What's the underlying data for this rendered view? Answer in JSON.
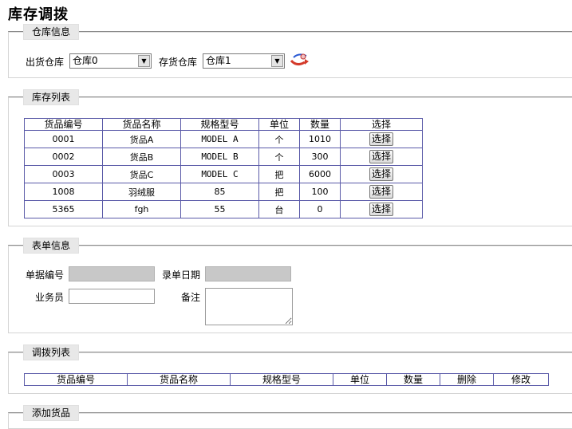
{
  "page": {
    "title": "库存调拨"
  },
  "warehouse_section": {
    "legend": "仓库信息",
    "out_label": "出货仓库",
    "out_value": "仓库0",
    "in_label": "存货仓库",
    "in_value": "仓库1",
    "transfer_icon": "transfer-icon"
  },
  "stock_section": {
    "legend": "库存列表",
    "columns": [
      "货品编号",
      "货品名称",
      "规格型号",
      "单位",
      "数量",
      "选择"
    ],
    "button_label": "选择",
    "rows": [
      {
        "code": "0001",
        "name": "货品A",
        "spec": "MODEL A",
        "unit": "个",
        "qty": "1010"
      },
      {
        "code": "0002",
        "name": "货品B",
        "spec": "MODEL B",
        "unit": "个",
        "qty": "300"
      },
      {
        "code": "0003",
        "name": "货品C",
        "spec": "MODEL C",
        "unit": "把",
        "qty": "6000"
      },
      {
        "code": "1008",
        "name": "羽绒服",
        "spec": "85",
        "unit": "把",
        "qty": "100"
      },
      {
        "code": "5365",
        "name": "fgh",
        "spec": "55",
        "unit": "台",
        "qty": "0"
      }
    ]
  },
  "form_section": {
    "legend": "表单信息",
    "doc_no_label": "单据编号",
    "doc_no_value": "",
    "date_label": "录单日期",
    "date_value": "",
    "clerk_label": "业务员",
    "clerk_value": "",
    "remark_label": "备注",
    "remark_value": ""
  },
  "transfer_section": {
    "legend": "调拨列表",
    "columns": [
      "货品编号",
      "货品名称",
      "规格型号",
      "单位",
      "数量",
      "删除",
      "修改"
    ]
  },
  "add_section": {
    "legend": "添加货品"
  }
}
